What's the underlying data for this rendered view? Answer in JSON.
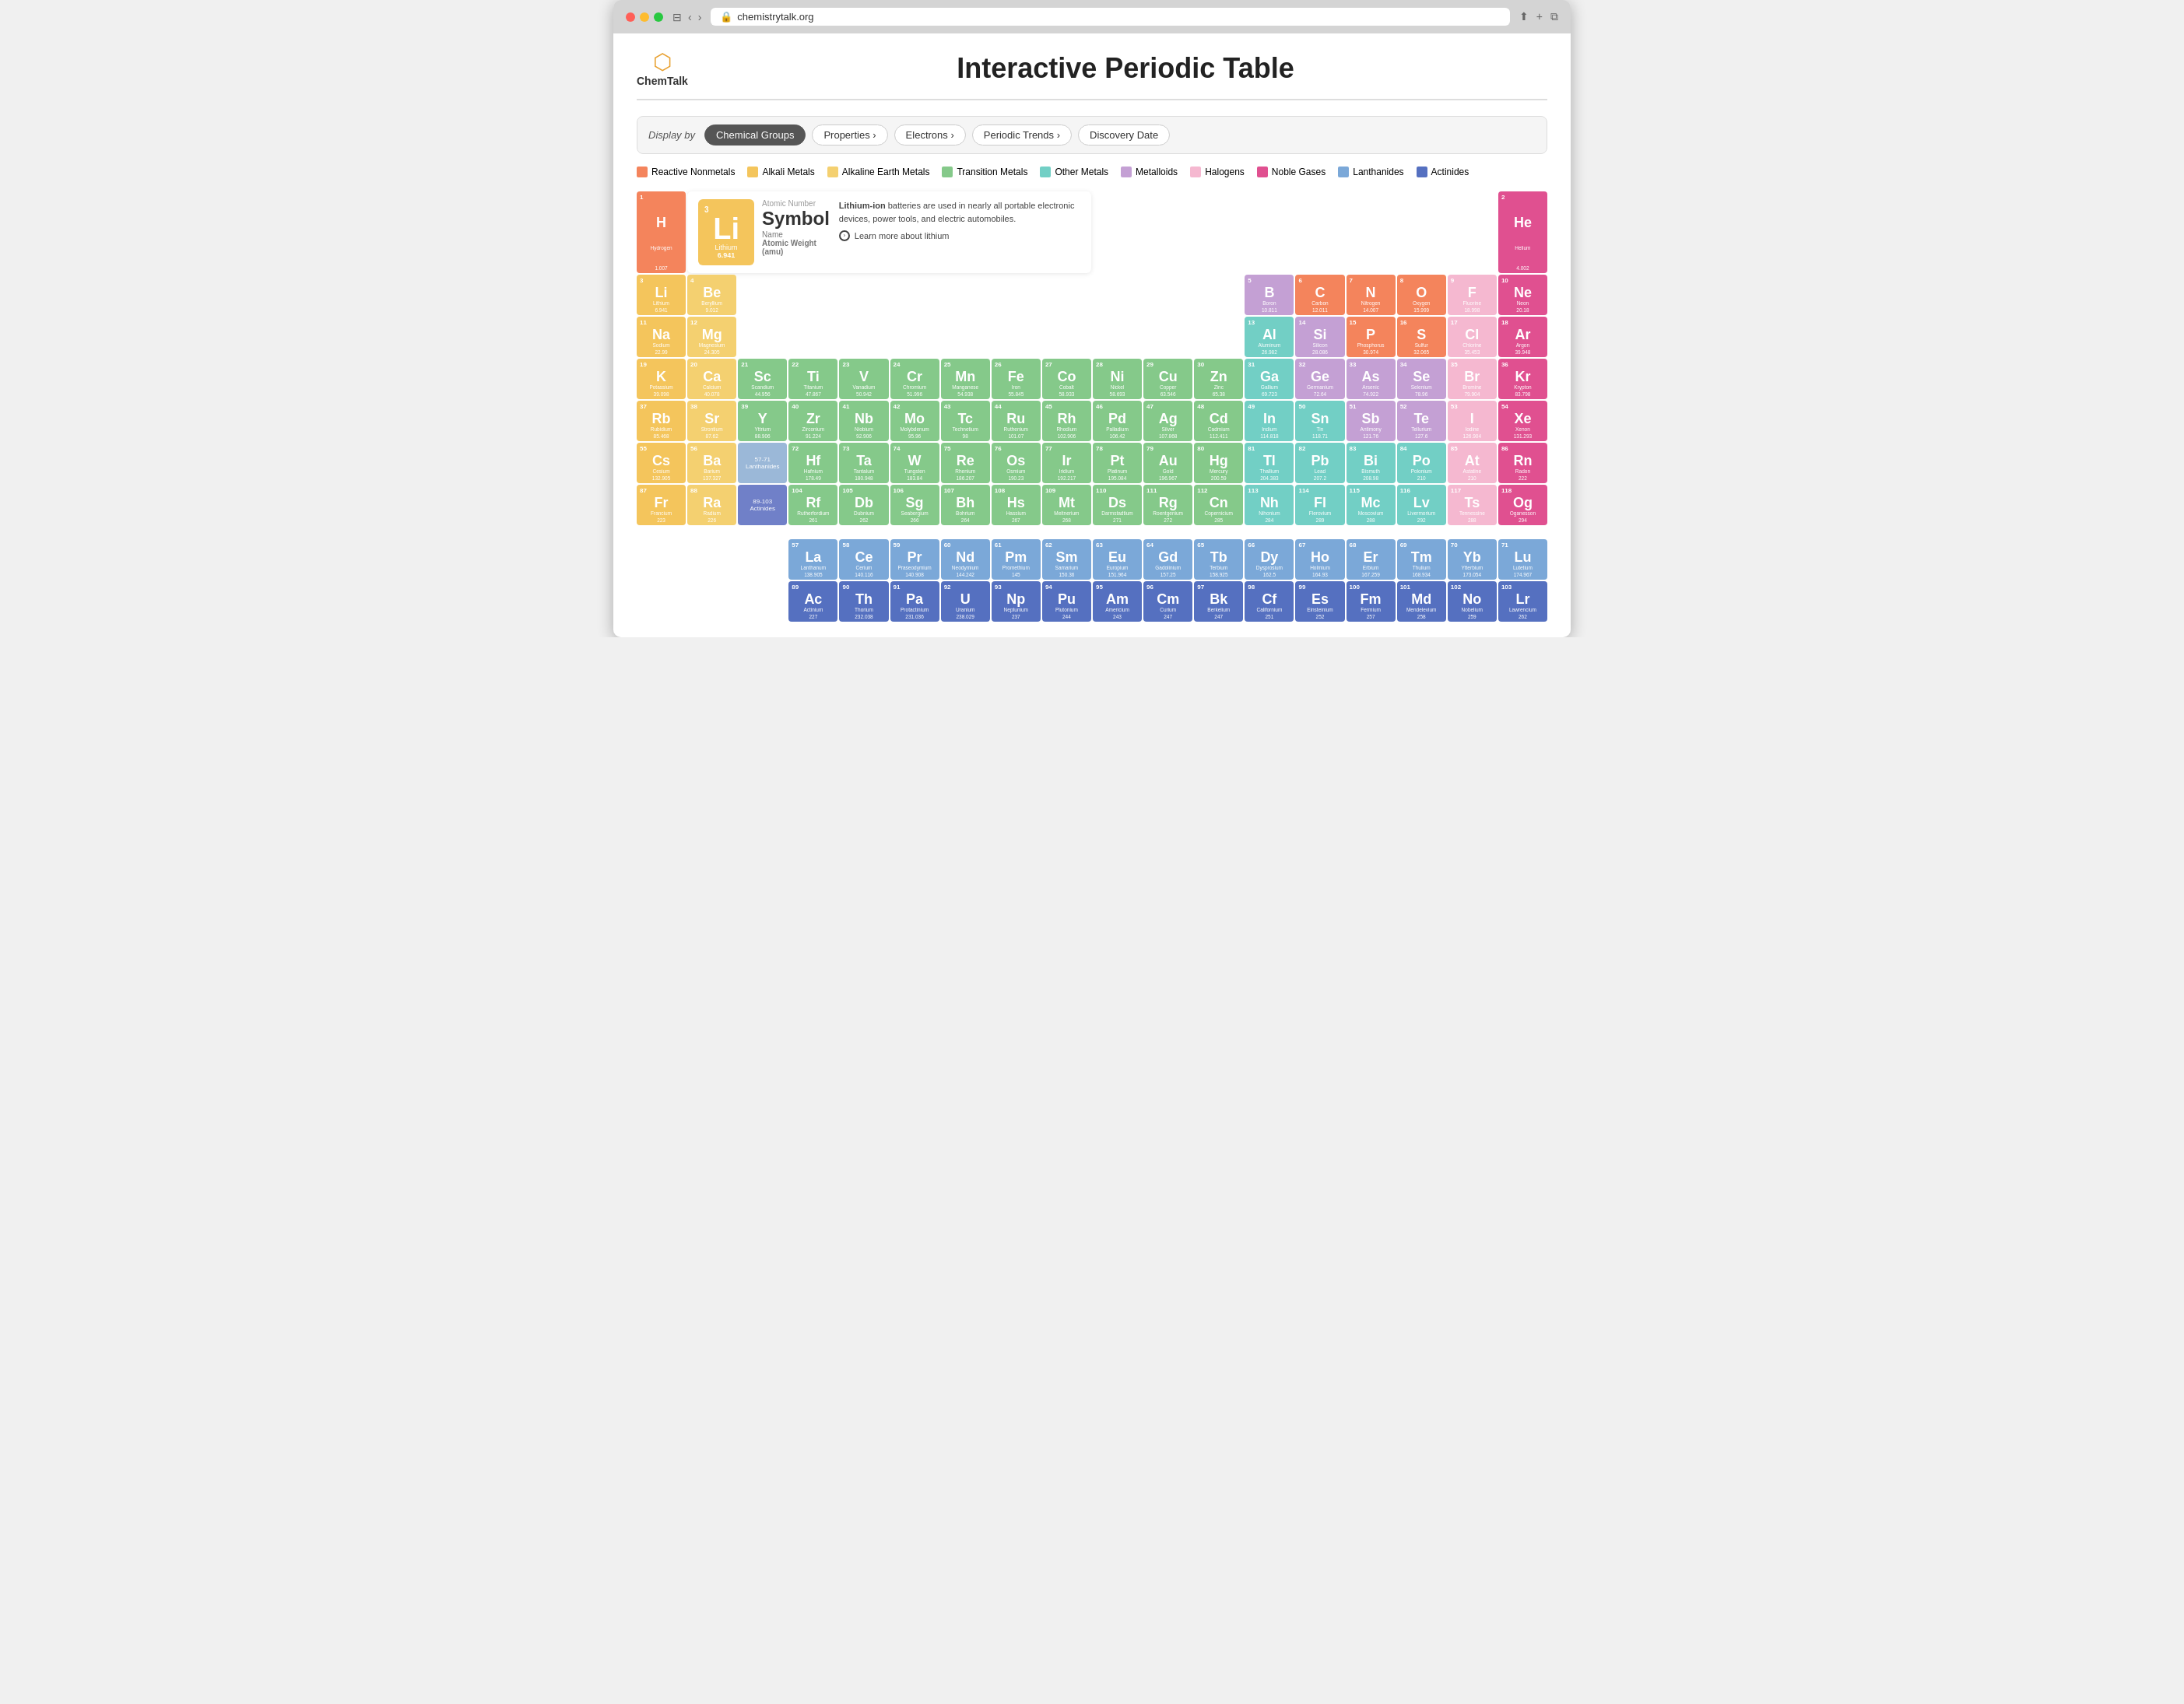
{
  "browser": {
    "url": "chemistrytalk.org",
    "title": "Interactive Periodic Table"
  },
  "header": {
    "logo_text": "ChemTalk",
    "page_title": "Interactive Periodic Table"
  },
  "display_bar": {
    "label": "Display by",
    "buttons": [
      {
        "label": "Chemical Groups",
        "active": true
      },
      {
        "label": "Properties ›"
      },
      {
        "label": "Electrons ›"
      },
      {
        "label": "Periodic Trends ›"
      },
      {
        "label": "Discovery Date"
      }
    ]
  },
  "legend": [
    {
      "label": "Reactive Nonmetals",
      "color": "#f4845c"
    },
    {
      "label": "Alkali Metals",
      "color": "#f4c55c"
    },
    {
      "label": "Alkaline Earth Metals",
      "color": "#f4d070"
    },
    {
      "label": "Transition Metals",
      "color": "#85c98a"
    },
    {
      "label": "Other Metals",
      "color": "#72cfc5"
    },
    {
      "label": "Metalloids",
      "color": "#c4a0d4"
    },
    {
      "label": "Halogens",
      "color": "#f5b8d0"
    },
    {
      "label": "Noble Gases",
      "color": "#e05090"
    },
    {
      "label": "Lanthanides",
      "color": "#7ba8d8"
    },
    {
      "label": "Actinides",
      "color": "#5570c0"
    }
  ],
  "popup": {
    "atomic_num": "3",
    "symbol": "Li",
    "name": "Lithium",
    "weight": "6.941",
    "label_num": "Atomic Number",
    "label_sym": "Symbol",
    "label_name": "Name",
    "label_weight": "Atomic Weight (amu)",
    "description": "Lithium-ion batteries are used in nearly all portable electronic devices, power tools, and electric automobiles.",
    "link_text": "Learn more about lithium"
  }
}
